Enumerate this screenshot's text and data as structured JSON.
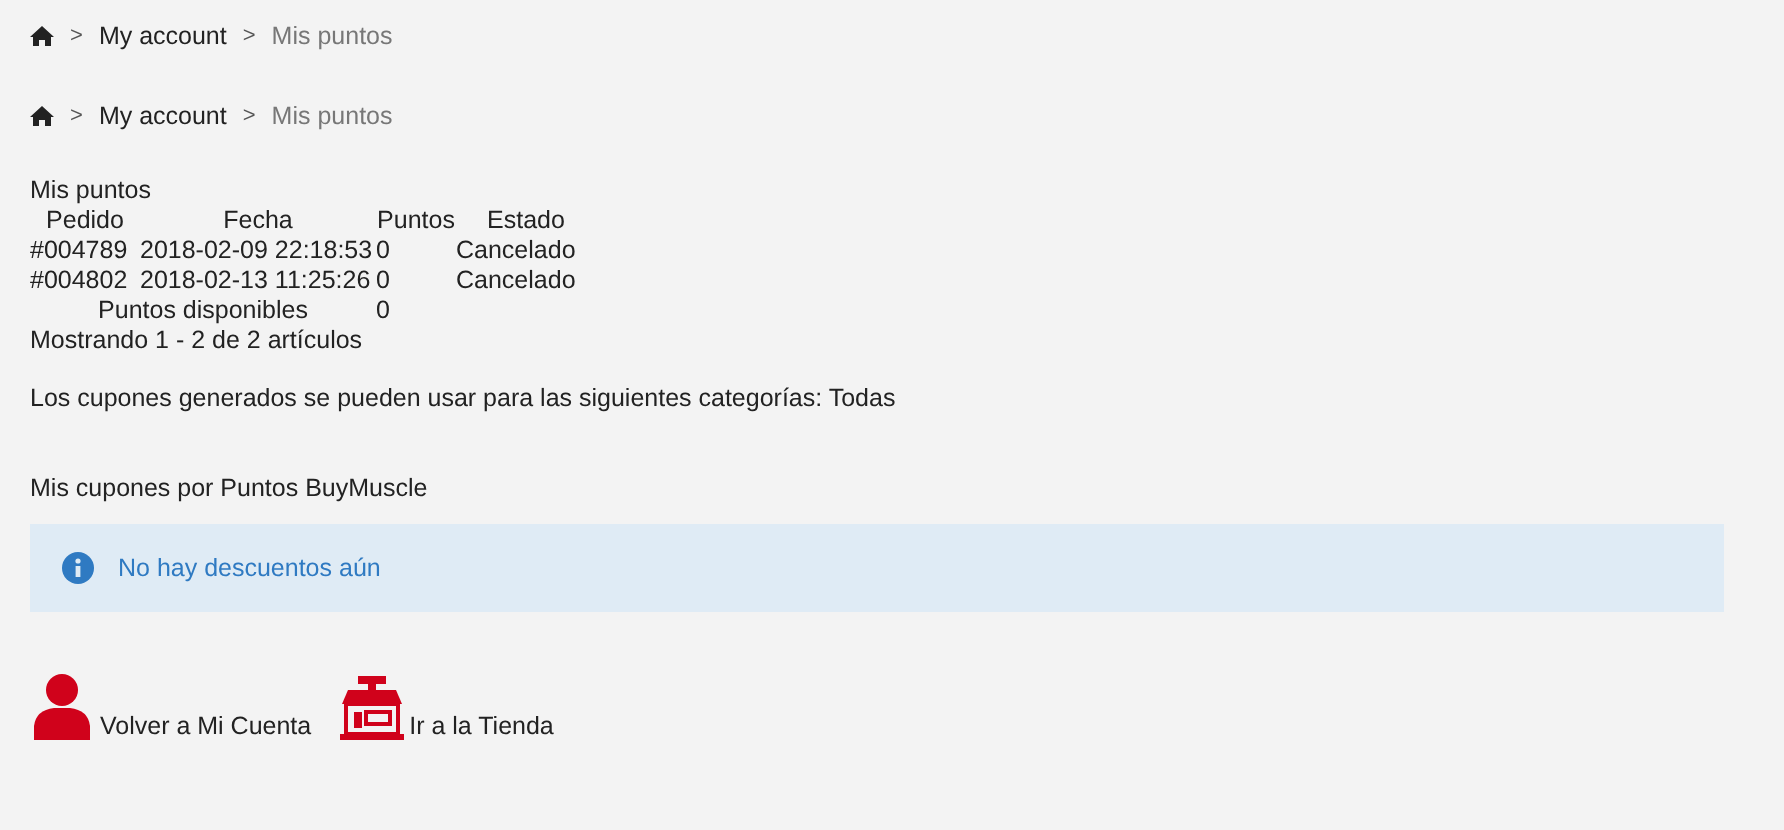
{
  "breadcrumbs": [
    {
      "items": [
        {
          "separator": ">",
          "label": "My account",
          "current": false
        },
        {
          "separator": ">",
          "label": "Mis puntos",
          "current": true
        }
      ]
    },
    {
      "items": [
        {
          "separator": ">",
          "label": "My account",
          "current": false
        },
        {
          "separator": ">",
          "label": "Mis puntos",
          "current": true
        }
      ]
    }
  ],
  "points_table": {
    "title": "Mis puntos",
    "columns": [
      "Pedido",
      "Fecha",
      "Puntos",
      "Estado"
    ],
    "rows": [
      {
        "cells": [
          "#004789",
          "2018-02-09 22:18:53",
          "0",
          "Cancelado"
        ]
      },
      {
        "cells": [
          "#004802",
          "2018-02-13 11:25:26",
          "0",
          "Cancelado"
        ]
      }
    ],
    "total_label": "Puntos disponibles",
    "total_value": "0",
    "pagination": "Mostrando 1 - 2 de 2 artículos"
  },
  "categories_note": "Los cupones generados se pueden usar para las siguientes categorías: Todas",
  "coupons": {
    "title": "Mis cupones por Puntos BuyMuscle",
    "alert": "No hay descuentos aún"
  },
  "links": [
    {
      "kind": "account",
      "label": "Volver a Mi Cuenta"
    },
    {
      "kind": "store",
      "label": "Ir a la Tienda"
    }
  ]
}
